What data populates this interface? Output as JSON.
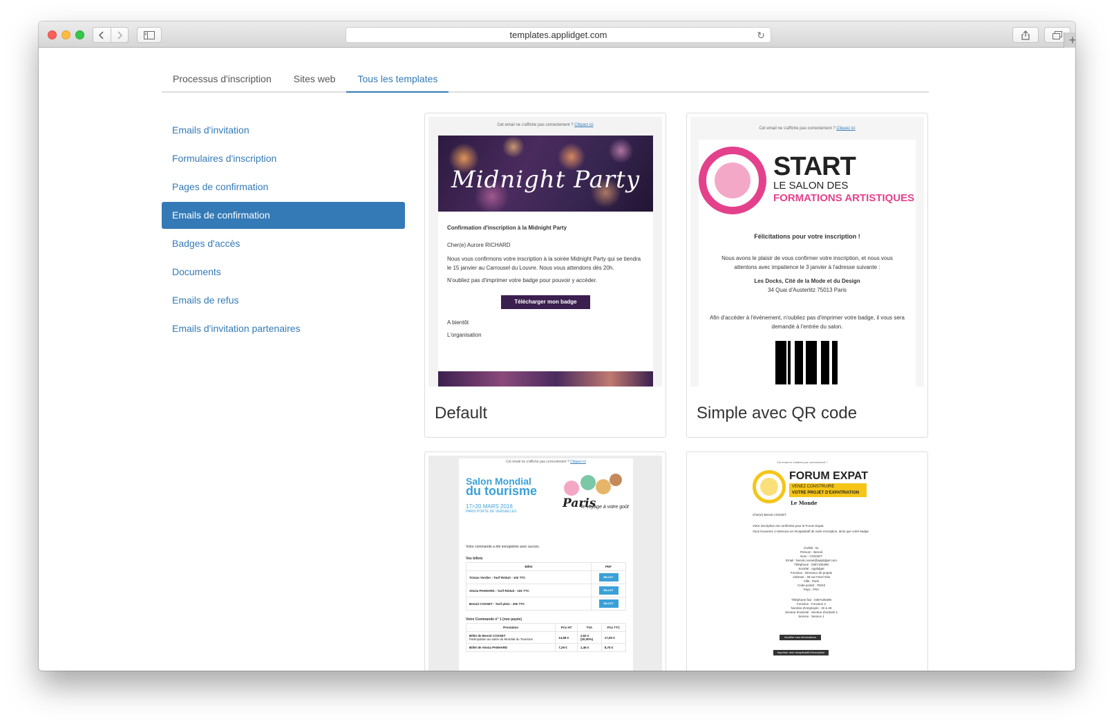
{
  "browser": {
    "url": "templates.applidget.com"
  },
  "tabs": [
    {
      "label": "Processus d'inscription",
      "active": false
    },
    {
      "label": "Sites web",
      "active": false
    },
    {
      "label": "Tous les templates",
      "active": true
    }
  ],
  "side_nav": [
    {
      "label": "Emails d'invitation",
      "active": false
    },
    {
      "label": "Formulaires d'inscription",
      "active": false
    },
    {
      "label": "Pages de confirmation",
      "active": false
    },
    {
      "label": "Emails de confirmation",
      "active": true
    },
    {
      "label": "Badges d'accès",
      "active": false
    },
    {
      "label": "Documents",
      "active": false
    },
    {
      "label": "Emails de refus",
      "active": false
    },
    {
      "label": "Emails d'invitation partenaires",
      "active": false
    }
  ],
  "templates": {
    "default": {
      "title": "Default",
      "note": "Cet email ne s'affiche pas correctement ?",
      "note_link": "Cliquez ici",
      "banner_title": "Midnight Party",
      "heading": "Confirmation d'inscription à la Midnight Party",
      "greeting": "Cher(e) Aurore RICHARD",
      "body": "Nous vous confirmons votre inscription à la soirée Midnight Party qui se tiendra le 15 janvier au Carrousel du Louvre. Nous vous attendons dès 20h.",
      "reminder": "N'oubliez pas d'imprimer votre badge pour pouvoir y accéder.",
      "button": "Télécharger mon badge",
      "closing": "A bientôt",
      "signature": "L'organisation"
    },
    "qr": {
      "title": "Simple avec QR code",
      "note": "Cet email ne s'affiche pas correctement ?",
      "note_link": "Cliquez ici",
      "logo_big": "START",
      "logo_line1": "LE SALON DES",
      "logo_line2": "FORMATIONS ARTISTIQUES",
      "heading": "Félicitations pour votre inscription !",
      "body": "Nous avons le plaisir de vous confirmer votre inscription, et nous vous attentons avec impatience le 3 janvier à l'adresse suivante :",
      "venue": "Les Docks, Cité de la Mode et du Design",
      "address": "34 Quai d'Austerlitz 75013 Paris",
      "reminder": "Afin d'accéder à l'événement, n'oubliez pas d'imprimer votre badge, il vous sera demandé à l'entrée du salon."
    },
    "tourisme": {
      "note": "Cet email ne s'affiche pas correctement ?",
      "note_link": "Cliquez ici",
      "title_line1": "Salon Mondial",
      "title_line2": "du tourisme",
      "dates": "17>20 MARS 2016",
      "place": "PARIS PORTE DE VERSAILLES",
      "paris": "Paris",
      "tagline": "le voyage à votre goût",
      "success": "Votre commande a été enregistrée avec succès.",
      "tickets_label": "Vos billets",
      "tickets_headers": [
        "Billet",
        "PDF"
      ],
      "tickets": [
        {
          "name": "Tristan Verdier : Tarif Réduit - 10€ TTC",
          "btn": "BILLET"
        },
        {
          "name": "Alexia PANHARD : Tarif Réduit - 10€ TTC",
          "btn": "BILLET"
        },
        {
          "name": "Benoit COSSET : Tarif plein - 20€ TTC",
          "btn": "BILLET"
        }
      ],
      "order_label": "Votre Commande n° 1 (non payée)",
      "order_headers": [
        "Prestation",
        "Prix HT",
        "TVA",
        "Prix TTC"
      ],
      "order_rows": [
        {
          "name": "Billet de Benoit COSSET",
          "desc": "Participation au salon du Mondial du Tourisme",
          "ht": "14,58 €",
          "tva": "2,92 €",
          "tva2": "(20,00%)",
          "ttc": "17,50 €"
        },
        {
          "name": "Billet de Alexia PANHARD",
          "desc": "",
          "ht": "7,29 €",
          "tva": "1,46 €",
          "tva2": "",
          "ttc": "8,75 €"
        }
      ]
    },
    "forum": {
      "top_note": "Cet email ne s'affiche pas correctement ?",
      "title": "FORUM EXPAT",
      "sub1": "VENEZ CONSTRUIRE",
      "sub2": "VOTRE PROJET D'EXPATRIATION",
      "partner": "Le Monde",
      "greeting": "Cher(e) Benoit COSSET",
      "line1": "Votre inscription est confirmée pour le Forum Expat.",
      "line2": "Vous trouverez ci-dessous un récapitulatif de votre inscription, ainsi que votre badge.",
      "fields": [
        "Civilité : M.",
        "Prénom : Benoit",
        "Nom : COSSET",
        "Email : benoit.cosset@applidget.com",
        "Téléphone : 0387106490",
        "Société : Applidget",
        "Fonction : Directeur de projets",
        "Adresse : 48 rue Farré Dist",
        "Ville : Paris",
        "Code postal : 75010",
        "Pays : FRA"
      ],
      "fields2": [
        "Téléphone fixe : 0387106490",
        "Fonction : Fonction 2",
        "Nombre d'employés : 20 à 49",
        "Secteur d'activité : Secteur d'activité 2",
        "Service : Service 1"
      ],
      "btn1": "Modifier mes informations",
      "btn2": "Imprimer mon récapitulatif d'inscription"
    }
  },
  "colors": {
    "accent": "#337ab7",
    "purple": "#3b1f4f",
    "pink": "#e4418c",
    "blue": "#3aa0d8",
    "yellow": "#f5c518"
  }
}
